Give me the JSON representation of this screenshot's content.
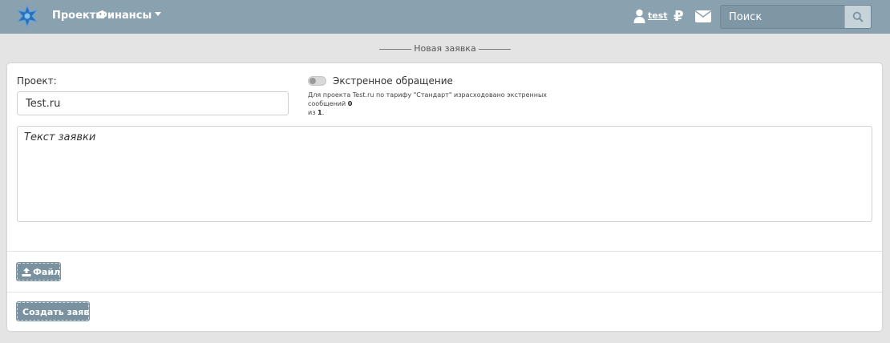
{
  "nav": {
    "projects": "Проекты",
    "finance": "Финансы",
    "user": "test",
    "ruble_symbol": "₽",
    "search_placeholder": "Поиск",
    "icons": [
      "logo-star-icon",
      "user-icon",
      "ruble-icon",
      "mail-icon",
      "search-icon",
      "caret-down-icon"
    ]
  },
  "page": {
    "title": "Новая заявка"
  },
  "form": {
    "project_label": "Проект:",
    "project_value": "Test.ru",
    "emergency_label": "Экстренное обращение",
    "emergency_enabled": false,
    "note_text": "Для проекта Test.ru по тарифу \"Стандарт\" израсходовано экстренных сообщений",
    "note_used": "0",
    "note_of": "из",
    "note_total": "1",
    "text_placeholder": "Текст заявки",
    "file_button": "Файл",
    "submit_button": "Создать заявку"
  },
  "colors": {
    "navbar": "#8aa2b0",
    "button": "#7a92a0",
    "background": "#e4e4e4",
    "card": "#ffffff"
  }
}
